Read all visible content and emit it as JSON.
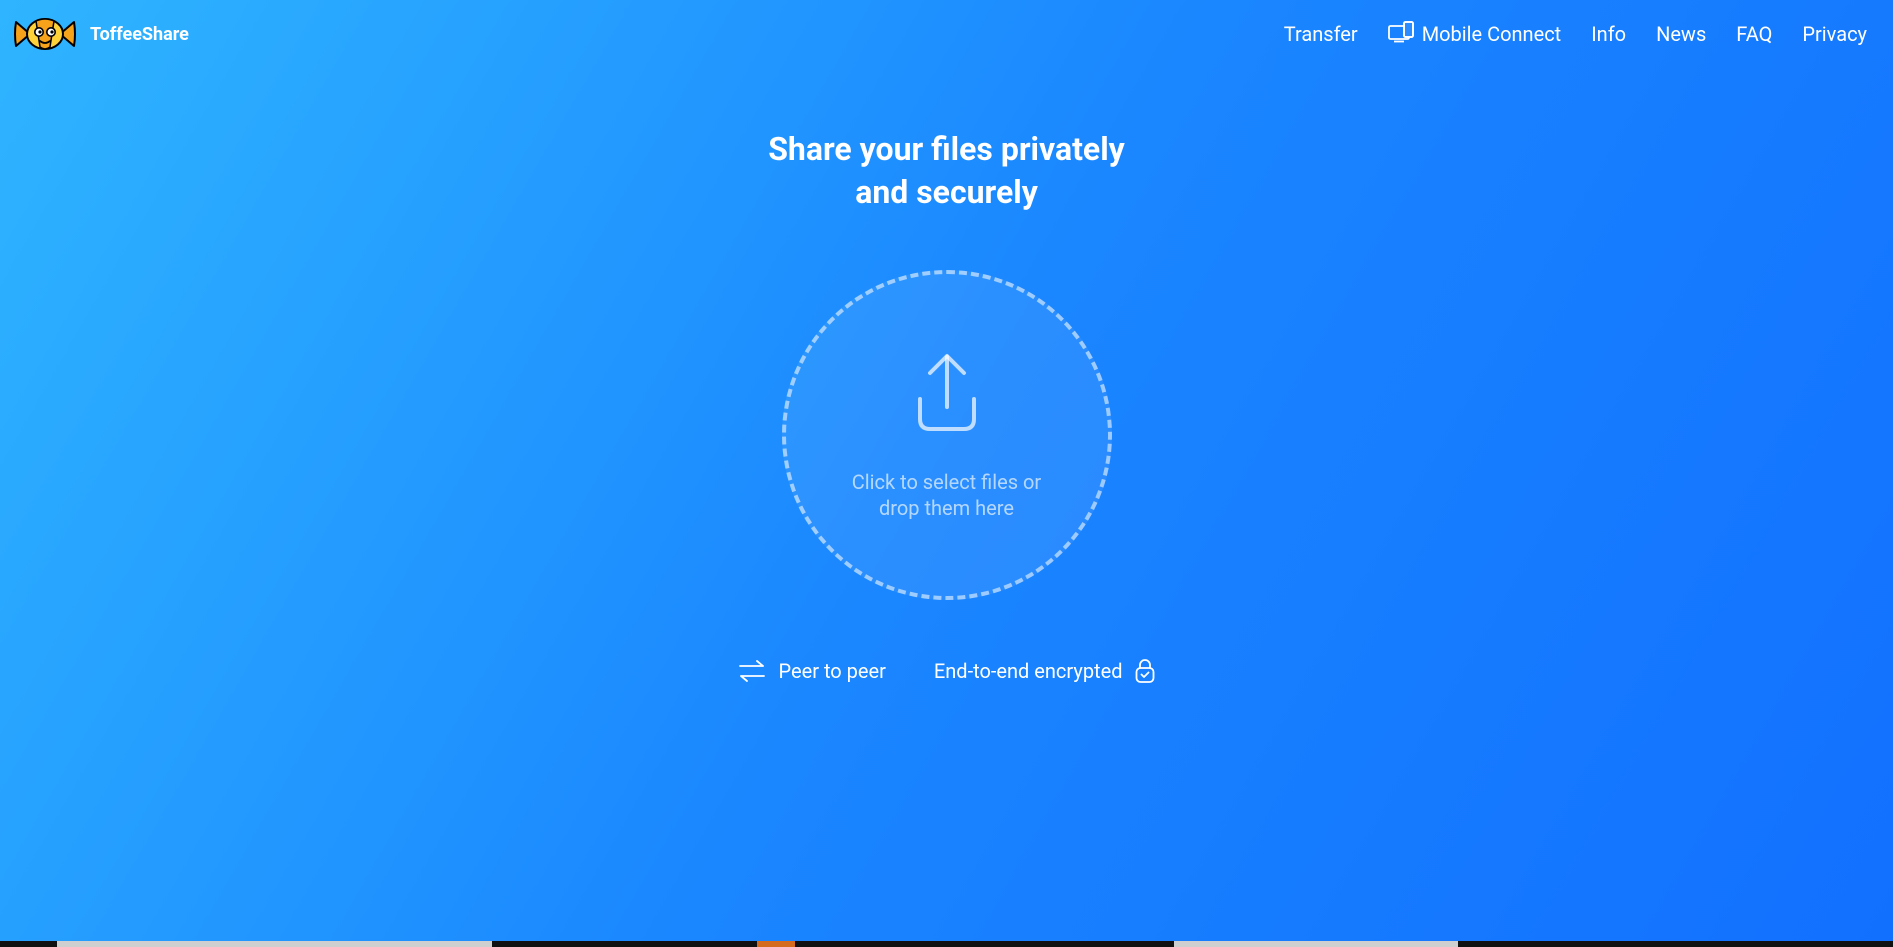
{
  "brand": {
    "name": "ToffeeShare"
  },
  "nav": {
    "transfer": "Transfer",
    "mobile_connect": "Mobile Connect",
    "info": "Info",
    "news": "News",
    "faq": "FAQ",
    "privacy": "Privacy"
  },
  "hero": {
    "title_line1": "Share your files privately",
    "title_line2": "and securely"
  },
  "dropzone": {
    "text": "Click to select files or drop them here"
  },
  "features": {
    "p2p": "Peer to peer",
    "e2e": "End-to-end encrypted"
  }
}
